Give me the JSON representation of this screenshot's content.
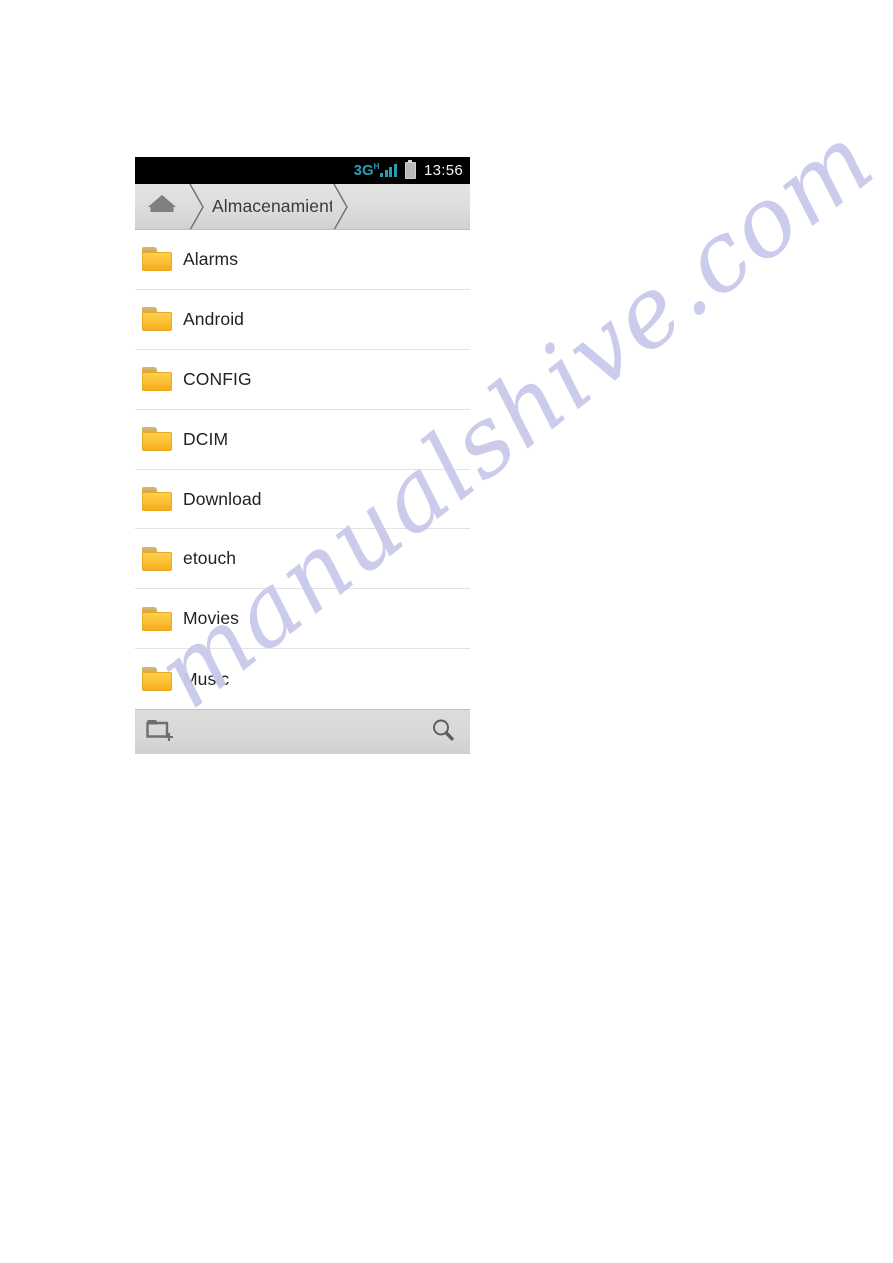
{
  "statusbar": {
    "network_label": "3G",
    "network_superscript": "H",
    "network_color": "#2c9bb5",
    "signal_bars": 4,
    "battery_icon": "battery-icon",
    "time": "13:56"
  },
  "breadcrumb": {
    "home_icon": "home-icon",
    "separator_icon": "chevron-right-icon",
    "path_label": "Almacenamiento"
  },
  "filelist": {
    "items": [
      {
        "icon": "folder-icon",
        "name": "Alarms"
      },
      {
        "icon": "folder-icon",
        "name": "Android"
      },
      {
        "icon": "folder-icon",
        "name": "CONFIG"
      },
      {
        "icon": "folder-icon",
        "name": "DCIM"
      },
      {
        "icon": "folder-icon",
        "name": "Download"
      },
      {
        "icon": "folder-icon",
        "name": "etouch"
      },
      {
        "icon": "folder-icon",
        "name": "Movies"
      },
      {
        "icon": "folder-icon",
        "name": "Music"
      }
    ]
  },
  "bottombar": {
    "new_folder_icon": "new-folder-icon",
    "search_icon": "search-icon"
  },
  "watermark": {
    "text": "manualshive.com",
    "color": "#c9c9ea"
  },
  "theme": {
    "folder_yellow": "#fcc43a",
    "folder_tab": "#d8b870",
    "statusbar_bg": "#000000",
    "chrome_grey": "#dcdcdc",
    "text_dark": "#222222"
  }
}
